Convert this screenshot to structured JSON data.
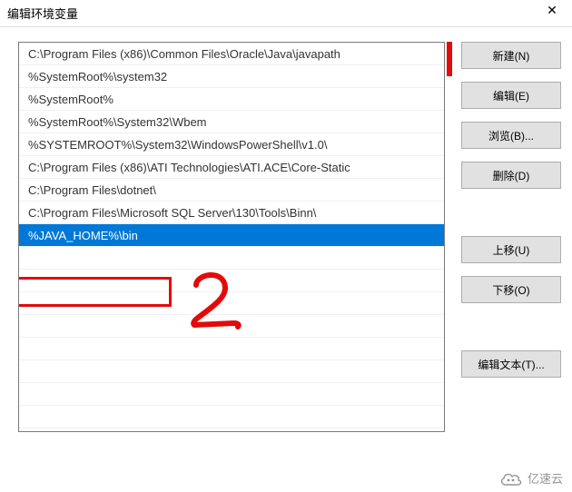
{
  "window": {
    "title": "编辑环境变量",
    "close_glyph": "✕"
  },
  "list": {
    "items": [
      "C:\\Program Files (x86)\\Common Files\\Oracle\\Java\\javapath",
      "%SystemRoot%\\system32",
      "%SystemRoot%",
      "%SystemRoot%\\System32\\Wbem",
      "%SYSTEMROOT%\\System32\\WindowsPowerShell\\v1.0\\",
      "C:\\Program Files (x86)\\ATI Technologies\\ATI.ACE\\Core-Static",
      "C:\\Program Files\\dotnet\\",
      "C:\\Program Files\\Microsoft SQL Server\\130\\Tools\\Binn\\",
      "%JAVA_HOME%\\bin"
    ],
    "selected_index": 8
  },
  "buttons": {
    "new": "新建(N)",
    "edit": "编辑(E)",
    "browse": "浏览(B)...",
    "delete": "删除(D)",
    "moveup": "上移(U)",
    "movedown": "下移(O)",
    "edittext": "编辑文本(T)..."
  },
  "annotation": {
    "number": "2"
  },
  "watermark": {
    "text": "亿速云"
  }
}
